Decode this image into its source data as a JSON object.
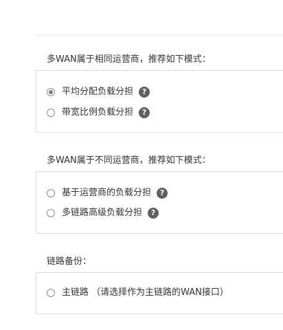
{
  "sections": [
    {
      "title": "多WAN属于相同运营商，推荐如下模式：",
      "options": [
        {
          "label": "平均分配负载分担",
          "checked": true,
          "help_icon": "question-circle-icon"
        },
        {
          "label": "带宽比例负载分担",
          "checked": false,
          "help_icon": "question-circle-icon"
        }
      ]
    },
    {
      "title": "多WAN属于不同运营商，推荐如下模式：",
      "options": [
        {
          "label": "基于运营商的负载分担",
          "checked": false,
          "help_icon": "question-circle-icon"
        },
        {
          "label": "多链路高级负载分担",
          "checked": false,
          "help_icon": "question-circle-icon"
        }
      ]
    },
    {
      "title": "链路备份：",
      "options": [
        {
          "label": "主链路 （请选择作为主链路的WAN接口）",
          "checked": false
        }
      ]
    }
  ],
  "help_glyph": "?",
  "colors": {
    "text": "#333333",
    "border": "#dcdcdc",
    "help_icon_bg": "#5f5f5f",
    "radio_border": "#8a8a8a",
    "radio_dot": "#7a7a7a"
  }
}
